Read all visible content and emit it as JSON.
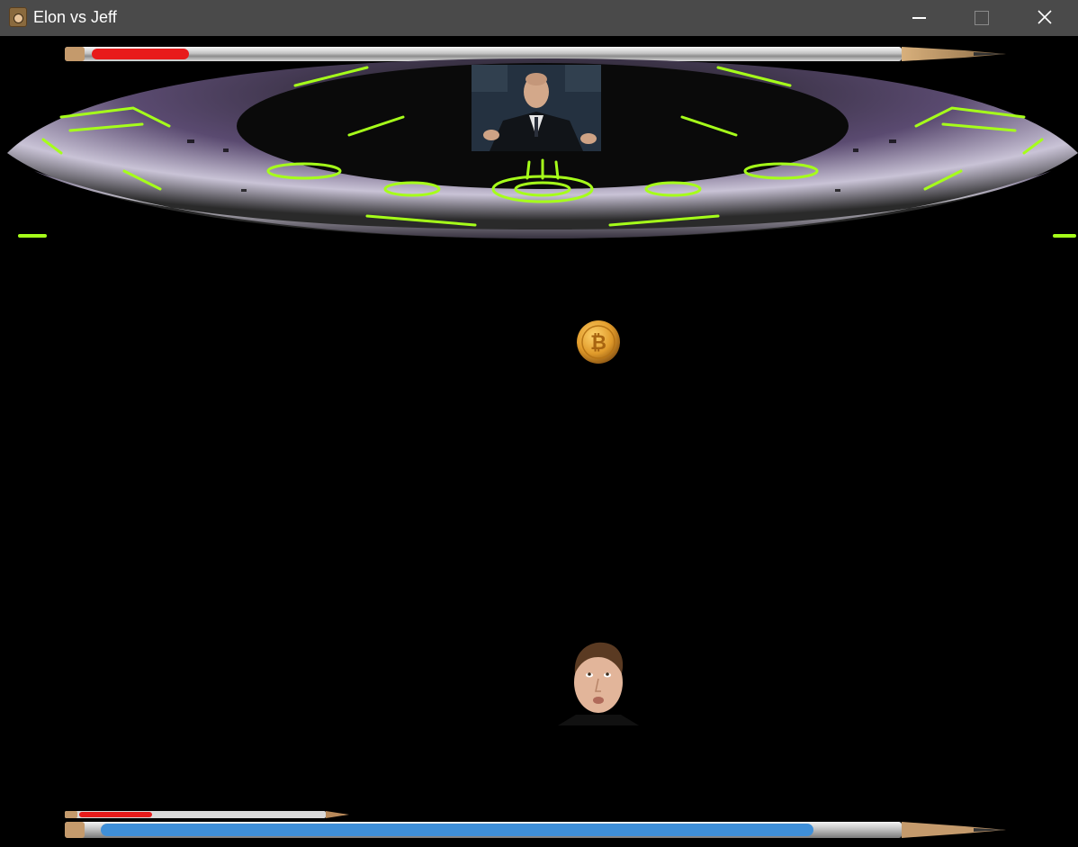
{
  "window": {
    "title": "Elon vs Jeff",
    "app_icon": "bear-icon",
    "controls": {
      "minimize_icon": "minimize-icon",
      "maximize_icon": "maximize-icon",
      "close_icon": "close-icon"
    }
  },
  "game": {
    "boss": {
      "name_icon": "jeff-portrait",
      "health_fraction": 0.12,
      "health_color": "#e81b1b"
    },
    "projectile": {
      "icon": "bitcoin-coin-icon"
    },
    "player": {
      "icon": "elon-head",
      "health_fraction": 0.3,
      "health_color": "#e81b1b",
      "energy_fraction": 0.88,
      "energy_color": "#3f8fd8"
    },
    "colors": {
      "background": "#000000",
      "ship_glow": "#a6ff1a",
      "ship_hull": "#6f5a8f"
    }
  }
}
